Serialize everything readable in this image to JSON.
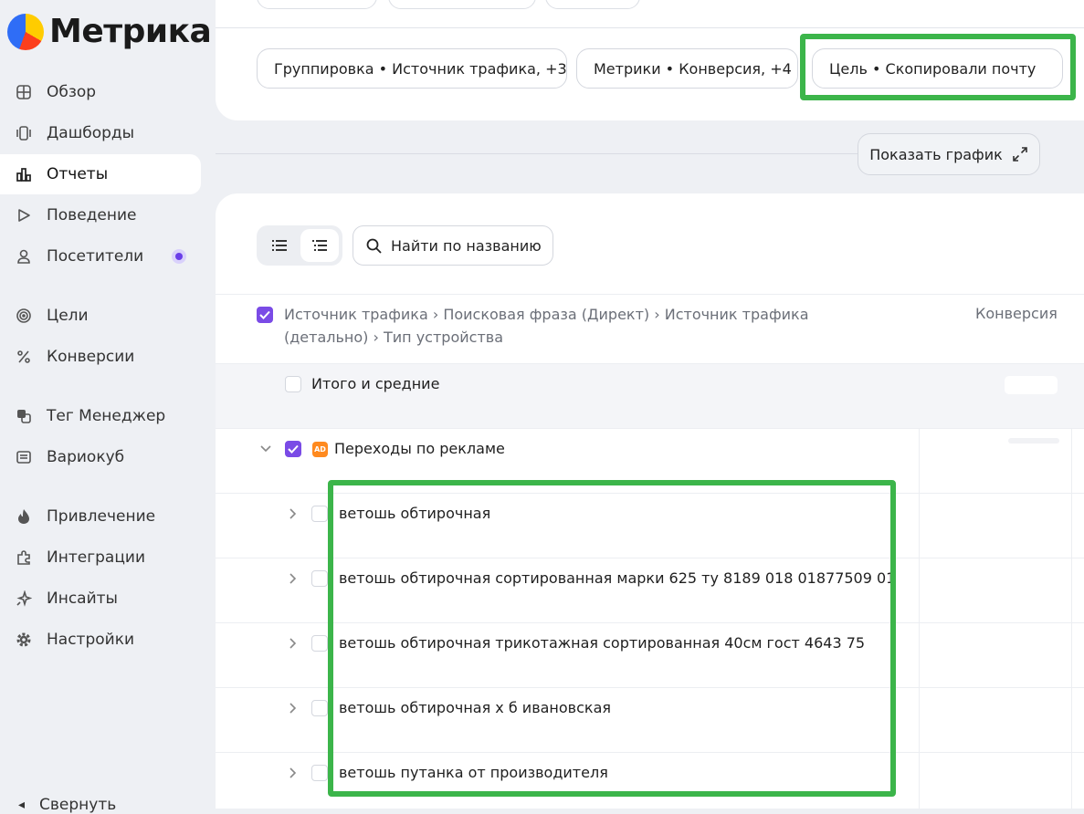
{
  "app": {
    "logo_text": "Метрика"
  },
  "sidebar": {
    "items": [
      {
        "label": "Обзор",
        "icon": "grid-icon"
      },
      {
        "label": "Дашборды",
        "icon": "dashboards-icon"
      },
      {
        "label": "Отчеты",
        "icon": "bar-chart-icon"
      },
      {
        "label": "Поведение",
        "icon": "play-icon"
      },
      {
        "label": "Посетители",
        "icon": "user-icon"
      },
      {
        "label": "Цели",
        "icon": "target-icon"
      },
      {
        "label": "Конверсии",
        "icon": "percent-icon"
      },
      {
        "label": "Тег Менеджер",
        "icon": "tag-manager-icon"
      },
      {
        "label": "Вариокуб",
        "icon": "variocube-icon"
      },
      {
        "label": "Привлечение",
        "icon": "flame-icon"
      },
      {
        "label": "Интеграции",
        "icon": "puzzle-icon"
      },
      {
        "label": "Инсайты",
        "icon": "sparkle-icon"
      },
      {
        "label": "Настройки",
        "icon": "gear-icon"
      }
    ],
    "active_item": "Отчеты",
    "collapse_label": "Свернуть"
  },
  "toolbar": {
    "grouping_label": "Группировка • Источник трафика, +3",
    "metrics_label": "Метрики • Конверсия, +4",
    "goal_label": "Цель • Скопировали почту"
  },
  "chart_button_label": "Показать график",
  "search": {
    "placeholder": "Найти по названию"
  },
  "table": {
    "dimensions_header": "Источник трафика › Поисковая фраза (Директ) › Источник трафика (детально) › Тип устройства",
    "metric_header": "Конверсия",
    "total_label": "Итого и средние",
    "group_label": "Переходы по рекламе",
    "group_badge": "AD",
    "rows": [
      {
        "label": "ветошь обтирочная"
      },
      {
        "label": "ветошь обтирочная сортированная марки 625 ту 8189 018 01877509 01"
      },
      {
        "label": "ветошь обтирочная трикотажная сортированная 40см гост 4643 75"
      },
      {
        "label": "ветошь обтирочная х б ивановская"
      },
      {
        "label": "ветошь путанка от производителя"
      }
    ]
  },
  "colors": {
    "accent": "#7a4be6",
    "highlight": "#3cb54a",
    "badge": "#ff8a1f"
  }
}
